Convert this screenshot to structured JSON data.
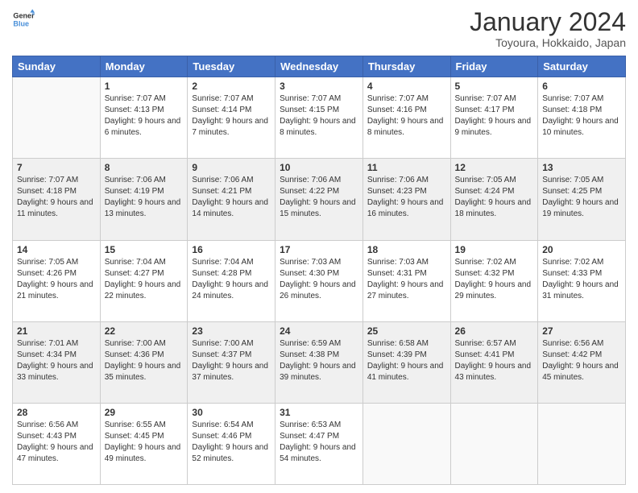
{
  "logo": {
    "line1": "General",
    "line2": "Blue"
  },
  "title": "January 2024",
  "subtitle": "Toyoura, Hokkaido, Japan",
  "days_of_week": [
    "Sunday",
    "Monday",
    "Tuesday",
    "Wednesday",
    "Thursday",
    "Friday",
    "Saturday"
  ],
  "weeks": [
    [
      {
        "day": "",
        "sunrise": "",
        "sunset": "",
        "daylight": ""
      },
      {
        "day": "1",
        "sunrise": "Sunrise: 7:07 AM",
        "sunset": "Sunset: 4:13 PM",
        "daylight": "Daylight: 9 hours and 6 minutes."
      },
      {
        "day": "2",
        "sunrise": "Sunrise: 7:07 AM",
        "sunset": "Sunset: 4:14 PM",
        "daylight": "Daylight: 9 hours and 7 minutes."
      },
      {
        "day": "3",
        "sunrise": "Sunrise: 7:07 AM",
        "sunset": "Sunset: 4:15 PM",
        "daylight": "Daylight: 9 hours and 8 minutes."
      },
      {
        "day": "4",
        "sunrise": "Sunrise: 7:07 AM",
        "sunset": "Sunset: 4:16 PM",
        "daylight": "Daylight: 9 hours and 8 minutes."
      },
      {
        "day": "5",
        "sunrise": "Sunrise: 7:07 AM",
        "sunset": "Sunset: 4:17 PM",
        "daylight": "Daylight: 9 hours and 9 minutes."
      },
      {
        "day": "6",
        "sunrise": "Sunrise: 7:07 AM",
        "sunset": "Sunset: 4:18 PM",
        "daylight": "Daylight: 9 hours and 10 minutes."
      }
    ],
    [
      {
        "day": "7",
        "sunrise": "Sunrise: 7:07 AM",
        "sunset": "Sunset: 4:18 PM",
        "daylight": "Daylight: 9 hours and 11 minutes."
      },
      {
        "day": "8",
        "sunrise": "Sunrise: 7:06 AM",
        "sunset": "Sunset: 4:19 PM",
        "daylight": "Daylight: 9 hours and 13 minutes."
      },
      {
        "day": "9",
        "sunrise": "Sunrise: 7:06 AM",
        "sunset": "Sunset: 4:21 PM",
        "daylight": "Daylight: 9 hours and 14 minutes."
      },
      {
        "day": "10",
        "sunrise": "Sunrise: 7:06 AM",
        "sunset": "Sunset: 4:22 PM",
        "daylight": "Daylight: 9 hours and 15 minutes."
      },
      {
        "day": "11",
        "sunrise": "Sunrise: 7:06 AM",
        "sunset": "Sunset: 4:23 PM",
        "daylight": "Daylight: 9 hours and 16 minutes."
      },
      {
        "day": "12",
        "sunrise": "Sunrise: 7:05 AM",
        "sunset": "Sunset: 4:24 PM",
        "daylight": "Daylight: 9 hours and 18 minutes."
      },
      {
        "day": "13",
        "sunrise": "Sunrise: 7:05 AM",
        "sunset": "Sunset: 4:25 PM",
        "daylight": "Daylight: 9 hours and 19 minutes."
      }
    ],
    [
      {
        "day": "14",
        "sunrise": "Sunrise: 7:05 AM",
        "sunset": "Sunset: 4:26 PM",
        "daylight": "Daylight: 9 hours and 21 minutes."
      },
      {
        "day": "15",
        "sunrise": "Sunrise: 7:04 AM",
        "sunset": "Sunset: 4:27 PM",
        "daylight": "Daylight: 9 hours and 22 minutes."
      },
      {
        "day": "16",
        "sunrise": "Sunrise: 7:04 AM",
        "sunset": "Sunset: 4:28 PM",
        "daylight": "Daylight: 9 hours and 24 minutes."
      },
      {
        "day": "17",
        "sunrise": "Sunrise: 7:03 AM",
        "sunset": "Sunset: 4:30 PM",
        "daylight": "Daylight: 9 hours and 26 minutes."
      },
      {
        "day": "18",
        "sunrise": "Sunrise: 7:03 AM",
        "sunset": "Sunset: 4:31 PM",
        "daylight": "Daylight: 9 hours and 27 minutes."
      },
      {
        "day": "19",
        "sunrise": "Sunrise: 7:02 AM",
        "sunset": "Sunset: 4:32 PM",
        "daylight": "Daylight: 9 hours and 29 minutes."
      },
      {
        "day": "20",
        "sunrise": "Sunrise: 7:02 AM",
        "sunset": "Sunset: 4:33 PM",
        "daylight": "Daylight: 9 hours and 31 minutes."
      }
    ],
    [
      {
        "day": "21",
        "sunrise": "Sunrise: 7:01 AM",
        "sunset": "Sunset: 4:34 PM",
        "daylight": "Daylight: 9 hours and 33 minutes."
      },
      {
        "day": "22",
        "sunrise": "Sunrise: 7:00 AM",
        "sunset": "Sunset: 4:36 PM",
        "daylight": "Daylight: 9 hours and 35 minutes."
      },
      {
        "day": "23",
        "sunrise": "Sunrise: 7:00 AM",
        "sunset": "Sunset: 4:37 PM",
        "daylight": "Daylight: 9 hours and 37 minutes."
      },
      {
        "day": "24",
        "sunrise": "Sunrise: 6:59 AM",
        "sunset": "Sunset: 4:38 PM",
        "daylight": "Daylight: 9 hours and 39 minutes."
      },
      {
        "day": "25",
        "sunrise": "Sunrise: 6:58 AM",
        "sunset": "Sunset: 4:39 PM",
        "daylight": "Daylight: 9 hours and 41 minutes."
      },
      {
        "day": "26",
        "sunrise": "Sunrise: 6:57 AM",
        "sunset": "Sunset: 4:41 PM",
        "daylight": "Daylight: 9 hours and 43 minutes."
      },
      {
        "day": "27",
        "sunrise": "Sunrise: 6:56 AM",
        "sunset": "Sunset: 4:42 PM",
        "daylight": "Daylight: 9 hours and 45 minutes."
      }
    ],
    [
      {
        "day": "28",
        "sunrise": "Sunrise: 6:56 AM",
        "sunset": "Sunset: 4:43 PM",
        "daylight": "Daylight: 9 hours and 47 minutes."
      },
      {
        "day": "29",
        "sunrise": "Sunrise: 6:55 AM",
        "sunset": "Sunset: 4:45 PM",
        "daylight": "Daylight: 9 hours and 49 minutes."
      },
      {
        "day": "30",
        "sunrise": "Sunrise: 6:54 AM",
        "sunset": "Sunset: 4:46 PM",
        "daylight": "Daylight: 9 hours and 52 minutes."
      },
      {
        "day": "31",
        "sunrise": "Sunrise: 6:53 AM",
        "sunset": "Sunset: 4:47 PM",
        "daylight": "Daylight: 9 hours and 54 minutes."
      },
      {
        "day": "",
        "sunrise": "",
        "sunset": "",
        "daylight": ""
      },
      {
        "day": "",
        "sunrise": "",
        "sunset": "",
        "daylight": ""
      },
      {
        "day": "",
        "sunrise": "",
        "sunset": "",
        "daylight": ""
      }
    ]
  ]
}
